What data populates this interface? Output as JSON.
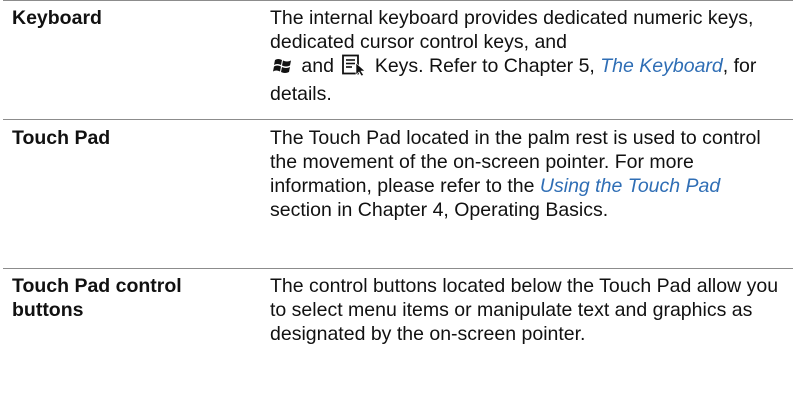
{
  "rows": [
    {
      "term": "Keyboard",
      "desc_1": "The internal keyboard provides dedicated numeric keys, dedicated cursor control keys, and",
      "icon_1": "windows-logo-key-icon",
      "desc_and": "and",
      "icon_2": "application-menu-key-icon",
      "desc_2": "Keys. Refer to Chapter 5, ",
      "link": "The Keyboard",
      "desc_3": ", for details."
    },
    {
      "term": "Touch Pad",
      "desc_1": "The Touch Pad located in the palm rest is used to control the movement of the on-screen pointer. For more information, please refer to the ",
      "link": "Using the Touch Pad",
      "desc_2": " section in Chapter 4, Operating Basics."
    },
    {
      "term": "Touch Pad control buttons",
      "desc": "The control buttons located below the Touch Pad allow you to select menu items or manipulate text and graphics as designated by the on-screen pointer."
    }
  ],
  "colors": {
    "link": "#2f6eb5",
    "rule": "#8c8c8c"
  }
}
